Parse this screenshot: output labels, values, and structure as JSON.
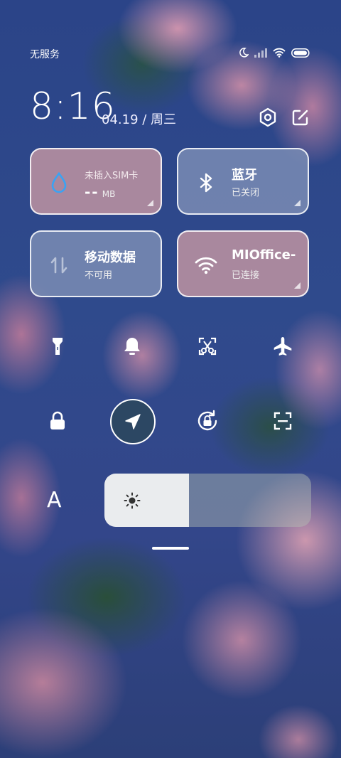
{
  "status_bar": {
    "carrier": "无服务",
    "icons": [
      "moon-icon",
      "signal-icon",
      "wifi-icon",
      "battery-icon"
    ]
  },
  "header": {
    "time": "8:16",
    "date": "04.19 / 周三",
    "settings_icon": "settings-hex-icon",
    "edit_icon": "edit-icon"
  },
  "tiles": {
    "sim": {
      "title": "未插入SIM卡",
      "value": "--",
      "unit": "MB",
      "icon": "data-drop-icon"
    },
    "bluetooth": {
      "title": "蓝牙",
      "status": "已关闭",
      "icon": "bluetooth-icon"
    },
    "mobile_data": {
      "title": "移动数据",
      "status": "不可用",
      "icon": "mobile-data-arrows-icon"
    },
    "wifi": {
      "title": "MIOffice-",
      "status": "已连接",
      "icon": "wifi-icon"
    }
  },
  "toggles_row1": [
    "flashlight-icon",
    "bell-icon",
    "screenshot-icon",
    "airplane-icon"
  ],
  "toggles_row2": [
    "lock-icon",
    "location-icon",
    "rotation-lock-icon",
    "scan-icon"
  ],
  "brightness": {
    "auto_label": "A",
    "level": 0.41,
    "icon": "sun-icon"
  },
  "colors": {
    "tile_pink": "#c496a2",
    "tile_blue": "#7a8cb4"
  }
}
